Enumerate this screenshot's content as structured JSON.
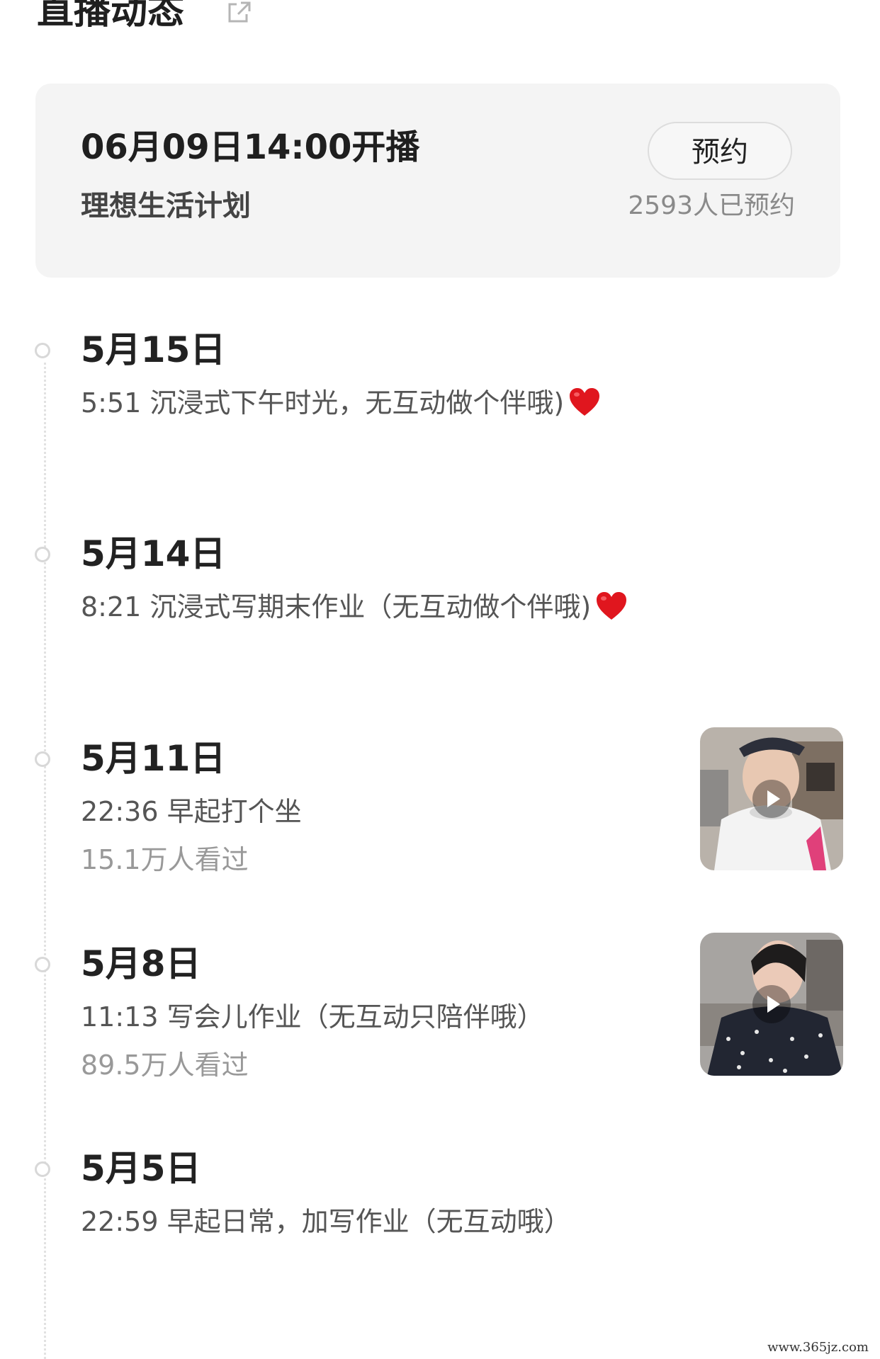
{
  "header": {
    "title": "直播动态",
    "link_icon": "external-link-icon"
  },
  "schedule": {
    "time": "06月09日14:00开播",
    "name": "理想生活计划",
    "button_label": "预约",
    "reserve_count": "2593人已预约"
  },
  "timeline": [
    {
      "date": "5月15日",
      "desc": "5:51 沉浸式下午时光，无互动做个伴哦)",
      "emoji": "heart-icon"
    },
    {
      "date": "5月14日",
      "desc": "8:21 沉浸式写期末作业（无互动做个伴哦)",
      "emoji": "heart-icon"
    },
    {
      "date": "5月11日",
      "desc": "22:36 早起打个坐",
      "views": "15.1万人看过",
      "thumbnail": "video-thumbnail"
    },
    {
      "date": "5月8日",
      "desc": "11:13 写会儿作业（无互动只陪伴哦）",
      "views": "89.5万人看过",
      "thumbnail": "video-thumbnail"
    },
    {
      "date": "5月5日",
      "desc": "22:59 早起日常，加写作业（无互动哦）"
    }
  ],
  "watermark": "www.365jz.com",
  "colors": {
    "card_background": "#f4f4f4",
    "heart": "#e0161e",
    "muted_text": "#999999"
  }
}
